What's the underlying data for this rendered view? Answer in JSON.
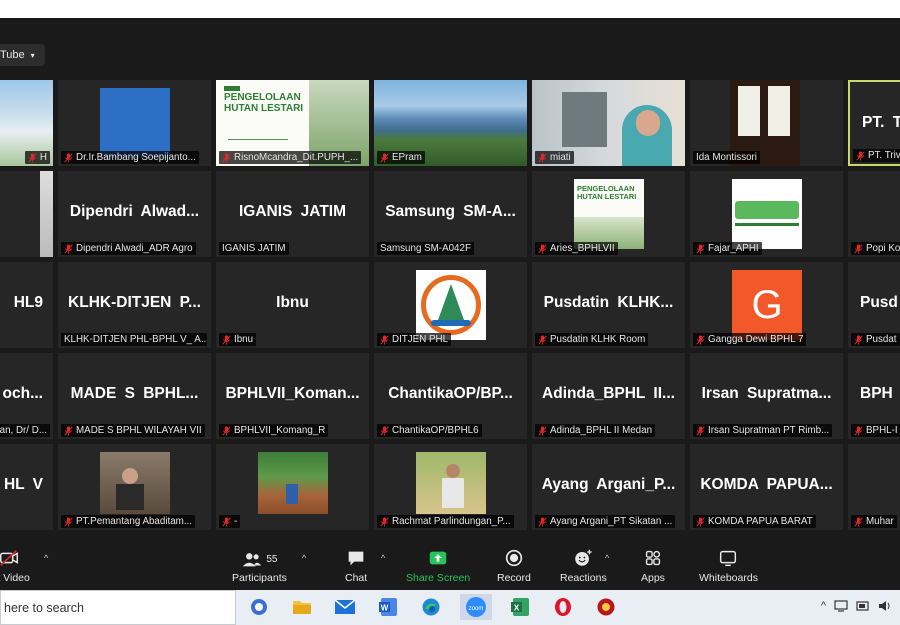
{
  "stream_button": {
    "label": "Tube",
    "caret": "▾"
  },
  "tiles": [
    {
      "col": 0,
      "row": 0,
      "label": "H",
      "big": "",
      "bg": "landscape"
    },
    {
      "col": 1,
      "row": 0,
      "label": "Dr.Ir.Bambang Soepijanto...",
      "big": "",
      "bg": "blue-square"
    },
    {
      "col": 2,
      "row": 0,
      "label": "RisnoMcandra_Dit.PUPH_...",
      "big": "",
      "bg": "slide",
      "slide_title": "PENGELOLAAN HUTAN LESTARI"
    },
    {
      "col": 3,
      "row": 0,
      "label": "EPram",
      "big": "",
      "bg": "lake"
    },
    {
      "col": 4,
      "row": 0,
      "label": "miati",
      "big": "",
      "bg": "person-office"
    },
    {
      "col": 5,
      "row": 0,
      "label": "Ida Montissori",
      "big": "",
      "bg": "window",
      "nomic": true
    },
    {
      "col": 6,
      "row": 0,
      "label": "PT. Triv",
      "big": "PT.  Tr",
      "bg": "plain",
      "active": true
    },
    {
      "col": 0,
      "row": 1,
      "label": "",
      "big": "",
      "bg": "person-left"
    },
    {
      "col": 1,
      "row": 1,
      "label": "Dipendri Alwadi_ADR Agro",
      "big": "Dipendri  Alwad...",
      "bg": "plain"
    },
    {
      "col": 2,
      "row": 1,
      "label": "IGANIS JATIM",
      "big": "IGANIS  JATIM",
      "bg": "plain",
      "nomic": true
    },
    {
      "col": 3,
      "row": 1,
      "label": "Samsung SM-A042F",
      "big": "Samsung  SM-A...",
      "bg": "plain",
      "nomic": true
    },
    {
      "col": 4,
      "row": 1,
      "label": "Aries_BPHLVII",
      "big": "",
      "bg": "slide-small",
      "slide_title": "PENGELOLAAN HUTAN LESTARI"
    },
    {
      "col": 5,
      "row": 1,
      "label": "Fajar_APHI",
      "big": "",
      "bg": "aphi"
    },
    {
      "col": 6,
      "row": 1,
      "label": "Popi Ko",
      "big": "",
      "bg": "plain"
    },
    {
      "col": 0,
      "row": 2,
      "label": "",
      "big": "HL9",
      "bg": "plain"
    },
    {
      "col": 1,
      "row": 2,
      "label": "KLHK-DITJEN PHL-BPHL V_ A...",
      "big": "KLHK-DITJEN  P...",
      "bg": "plain",
      "nomic": true
    },
    {
      "col": 2,
      "row": 2,
      "label": "Ibnu",
      "big": "Ibnu",
      "bg": "plain"
    },
    {
      "col": 3,
      "row": 2,
      "label": "DITJEN PHL",
      "big": "",
      "bg": "klhk-logo"
    },
    {
      "col": 4,
      "row": 2,
      "label": "Pusdatin KLHK Room",
      "big": "Pusdatin  KLHK...",
      "bg": "plain"
    },
    {
      "col": 5,
      "row": 2,
      "label": "Gangga Dewi BPHL 7",
      "big": "",
      "bg": "avatar-g",
      "avatar": "G"
    },
    {
      "col": 6,
      "row": 2,
      "label": "Pusdat",
      "big": "Pusd",
      "bg": "plain"
    },
    {
      "col": 0,
      "row": 3,
      "label": "an, Dr/ D...",
      "big": "och...",
      "bg": "plain",
      "nomic": true
    },
    {
      "col": 1,
      "row": 3,
      "label": "MADE S BPHL WILAYAH VII",
      "big": "MADE  S  BPHL...",
      "bg": "plain"
    },
    {
      "col": 2,
      "row": 3,
      "label": "BPHLVII_Komang_R",
      "big": "BPHLVII_Koman...",
      "bg": "plain"
    },
    {
      "col": 3,
      "row": 3,
      "label": "ChantikaOP/BPHL6",
      "big": "ChantikaOP/BP...",
      "bg": "plain"
    },
    {
      "col": 4,
      "row": 3,
      "label": "Adinda_BPHL II Medan",
      "big": "Adinda_BPHL  II...",
      "bg": "plain"
    },
    {
      "col": 5,
      "row": 3,
      "label": "Irsan Supratman PT Rimb...",
      "big": "Irsan  Supratma...",
      "bg": "plain"
    },
    {
      "col": 6,
      "row": 3,
      "label": "BPHL-I",
      "big": "BPH",
      "bg": "plain"
    },
    {
      "col": 0,
      "row": 4,
      "label": "",
      "big": "HL V",
      "bg": "plain"
    },
    {
      "col": 1,
      "row": 4,
      "label": "PT.Pemantang Abaditam...",
      "big": "",
      "bg": "photo-man"
    },
    {
      "col": 2,
      "row": 4,
      "label": "-",
      "big": "",
      "bg": "photo-field"
    },
    {
      "col": 3,
      "row": 4,
      "label": "Rachmat Parlindungan_P...",
      "big": "",
      "bg": "photo-tree"
    },
    {
      "col": 4,
      "row": 4,
      "label": "Ayang Argani_PT Sikatan ...",
      "big": "Ayang  Argani_P...",
      "bg": "plain"
    },
    {
      "col": 5,
      "row": 4,
      "label": "KOMDA PAPUA BARAT",
      "big": "KOMDA  PAPUA...",
      "bg": "plain"
    },
    {
      "col": 6,
      "row": 4,
      "label": "Muhar",
      "big": "",
      "bg": "photo-right"
    }
  ],
  "toolbar": {
    "start_video": "art Video",
    "participants": "Participants",
    "participants_count": "55",
    "chat": "Chat",
    "share_screen": "Share Screen",
    "record": "Record",
    "reactions": "Reactions",
    "apps": "Apps",
    "whiteboards": "Whiteboards",
    "share_color": "#27c45a"
  },
  "taskbar": {
    "search_placeholder": "here to search",
    "apps": [
      "chat-icon",
      "file-explorer-icon",
      "mail-icon",
      "word-icon",
      "edge-icon",
      "zoom-icon",
      "excel-icon",
      "opera-icon",
      "game-icon"
    ]
  }
}
